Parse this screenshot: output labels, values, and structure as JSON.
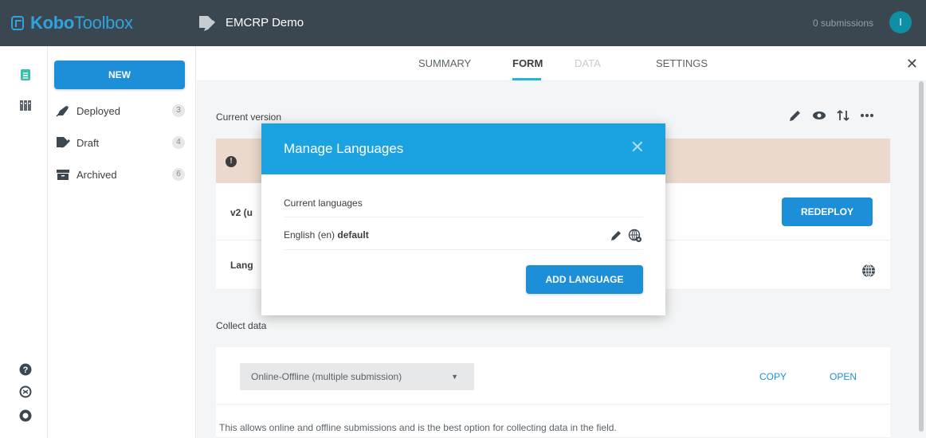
{
  "header": {
    "logo_bold": "Kobo",
    "logo_light": "Toolbox",
    "project_title": "EMCRP Demo",
    "submissions": "0 submissions",
    "avatar_initial": "I"
  },
  "drawer": {
    "new_label": "NEW",
    "items": [
      {
        "label": "Deployed",
        "count": "3",
        "icon": "rocket-icon"
      },
      {
        "label": "Draft",
        "count": "4",
        "icon": "draft-icon"
      },
      {
        "label": "Archived",
        "count": "6",
        "icon": "archive-icon"
      }
    ]
  },
  "tabs": [
    {
      "label": "SUMMARY",
      "state": "normal"
    },
    {
      "label": "FORM",
      "state": "active"
    },
    {
      "label": "DATA",
      "state": "disabled"
    },
    {
      "label": "SETTINGS",
      "state": "normal"
    }
  ],
  "main": {
    "current_version": "Current version",
    "version_text": "v2 (u",
    "languages_text": "Lang",
    "redeploy": "REDEPLOY",
    "collect_data": "Collect data",
    "collect_select": "Online-Offline (multiple submission)",
    "copy": "COPY",
    "open": "OPEN",
    "help": "This allows online and offline submissions and is the best option for collecting data in the field."
  },
  "modal": {
    "title": "Manage Languages",
    "current_languages": "Current languages",
    "lang_name": "English (en)",
    "lang_default": "default",
    "add_language": "ADD LANGUAGE"
  },
  "colors": {
    "topbar": "#3b4750",
    "accent": "#1d8fd9",
    "modal_header": "#1aa3e0",
    "tab_underline": "#25b3d7",
    "warning_bg": "#ead9cc"
  }
}
